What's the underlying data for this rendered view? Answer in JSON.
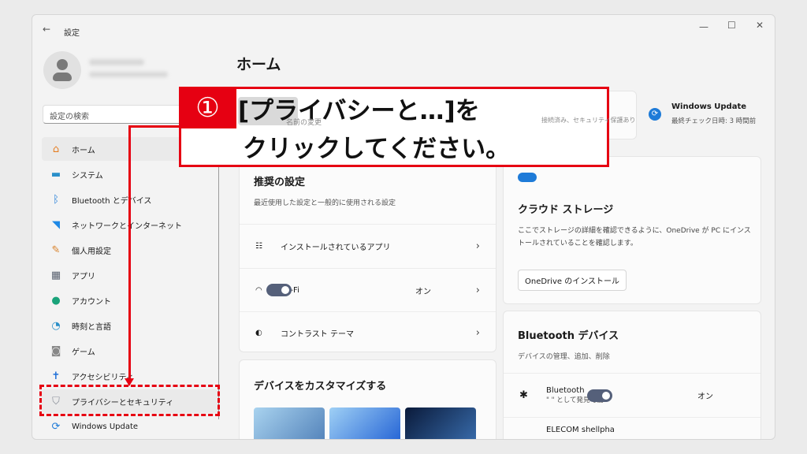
{
  "window": {
    "title": "設定",
    "back_icon": "arrow-left-icon",
    "controls": [
      "—",
      "☐",
      "✕"
    ]
  },
  "sidebar": {
    "search_placeholder": "設定の検索",
    "items": [
      {
        "label": "ホーム",
        "icon": "home-icon",
        "color": "#e67e22"
      },
      {
        "label": "システム",
        "icon": "monitor-icon",
        "color": "#2a8fc9"
      },
      {
        "label": "Bluetooth とデバイス",
        "icon": "bluetooth-icon",
        "color": "#1e7bd8"
      },
      {
        "label": "ネットワークとインターネット",
        "icon": "wifi-icon",
        "color": "#1e88e5"
      },
      {
        "label": "個人用設定",
        "icon": "brush-icon",
        "color": "#d9822b"
      },
      {
        "label": "アプリ",
        "icon": "apps-icon",
        "color": "#5a6270"
      },
      {
        "label": "アカウント",
        "icon": "account-icon",
        "color": "#1aa37a"
      },
      {
        "label": "時刻と言語",
        "icon": "clock-globe-icon",
        "color": "#2a8fc9"
      },
      {
        "label": "ゲーム",
        "icon": "gamepad-icon",
        "color": "#888888"
      },
      {
        "label": "アクセシビリティ",
        "icon": "accessibility-icon",
        "color": "#1e6fd8"
      },
      {
        "label": "プライバシーとセキュリティ",
        "icon": "shield-icon",
        "color": "#8a8f99"
      },
      {
        "label": "Windows Update",
        "icon": "update-icon",
        "color": "#1e7bd8"
      }
    ]
  },
  "main": {
    "title": "ホーム",
    "top": {
      "rename": "名前の変更",
      "network_status": "接続済み、セキュリティ保護あり",
      "update_title": "Windows Update",
      "update_status": "最終チェック日時: 3 時間前"
    },
    "recommended": {
      "title": "推奨の設定",
      "subtitle": "最近使用した設定と一般的に使用される設定",
      "rows": [
        {
          "label": "インストールされているアプリ",
          "icon": "list-icon"
        },
        {
          "label": "Wi-Fi",
          "icon": "wifi-icon",
          "toggle": "オン"
        },
        {
          "label": "コントラスト テーマ",
          "icon": "contrast-icon"
        }
      ]
    },
    "customize": {
      "title": "デバイスをカスタマイズする"
    },
    "cloud": {
      "title": "クラウド ストレージ",
      "desc": "ここでストレージの詳細を確認できるように、OneDrive が PC にインストールされていることを確認します。",
      "button": "OneDrive のインストール"
    },
    "bluetooth": {
      "title": "Bluetooth デバイス",
      "subtitle": "デバイスの管理、追加、削除",
      "row_title": "Bluetooth",
      "row_sub": "\"      \" として発見可能",
      "toggle": "オン",
      "next_device": "ELECOM shellpha"
    }
  },
  "callout": {
    "number": "①",
    "line1_hl": "[プラ",
    "line1": "イバシーと…]を",
    "line2": "クリックしてください。",
    "color": "#e60012"
  }
}
